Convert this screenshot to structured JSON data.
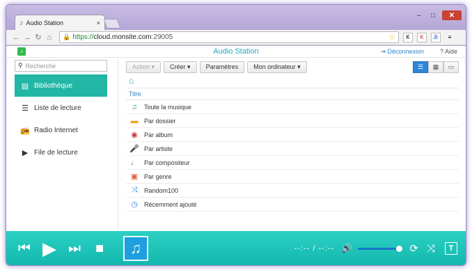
{
  "browser": {
    "tab_title": "Audio Station",
    "tab_close": "×",
    "url_scheme": "https://",
    "url_host": "cloud.monsite.com",
    "url_port": ":29005"
  },
  "app": {
    "title": "Audio Station",
    "logout": "Déconnexion",
    "help": "Aide"
  },
  "sidebar": {
    "search_placeholder": "Recherche",
    "items": [
      {
        "label": "Bibliothèque",
        "icon": "library-icon"
      },
      {
        "label": "Liste de lecture",
        "icon": "playlist-icon"
      },
      {
        "label": "Radio Internet",
        "icon": "radio-icon"
      },
      {
        "label": "File de lecture",
        "icon": "queue-icon"
      }
    ]
  },
  "toolbar": {
    "action": "Action ▾",
    "create": "Créer ▾",
    "settings": "Paramètres",
    "computer": "Mon ordinateur ▾"
  },
  "list": {
    "column_title": "Titre",
    "rows": [
      {
        "label": "Toute la musique",
        "icon": "music-note-icon"
      },
      {
        "label": "Par dossier",
        "icon": "folder-icon"
      },
      {
        "label": "Par album",
        "icon": "album-icon"
      },
      {
        "label": "Par artiste",
        "icon": "microphone-icon"
      },
      {
        "label": "Par compositeur",
        "icon": "composer-icon"
      },
      {
        "label": "Par genre",
        "icon": "genre-icon"
      },
      {
        "label": "Random100",
        "icon": "shuffle-icon"
      },
      {
        "label": "Récemment ajouté",
        "icon": "clock-icon"
      }
    ]
  },
  "player": {
    "time": "--:-- / --:--",
    "volume_level": 0.95
  },
  "colors": {
    "accent": "#22b6a5",
    "player": "#1ec3b8",
    "link": "#2f86c8"
  }
}
